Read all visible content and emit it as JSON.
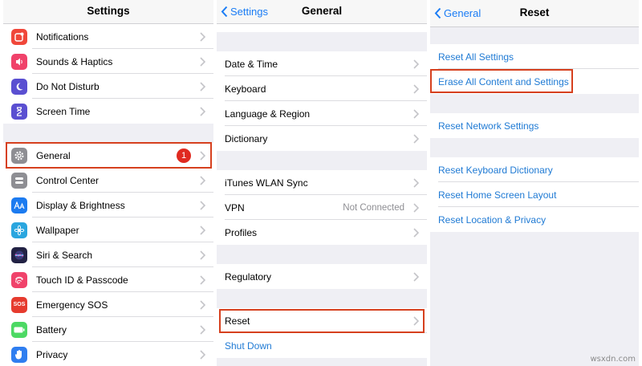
{
  "settings": {
    "title": "Settings",
    "group1": [
      {
        "label": "Notifications",
        "color": "#f0473a"
      },
      {
        "label": "Sounds & Haptics",
        "color": "#f0426a"
      },
      {
        "label": "Do Not Disturb",
        "color": "#5a4fd1"
      },
      {
        "label": "Screen Time",
        "color": "#5a4fd1"
      }
    ],
    "general": {
      "label": "General",
      "badge": "1",
      "color": "#8e8e93"
    },
    "group2": [
      {
        "label": "Control Center",
        "color": "#8e8e93"
      },
      {
        "label": "Display & Brightness",
        "color": "#1c7bf0"
      },
      {
        "label": "Wallpaper",
        "color": "#2aa6df"
      },
      {
        "label": "Siri & Search",
        "color": "#222244"
      },
      {
        "label": "Touch ID & Passcode",
        "color": "#f0426a"
      },
      {
        "label": "Emergency SOS",
        "color": "#e63b2e",
        "icon_text": "SOS"
      },
      {
        "label": "Battery",
        "color": "#4cd964"
      },
      {
        "label": "Privacy",
        "color": "#2f7ef0"
      }
    ]
  },
  "general": {
    "title": "General",
    "back": "Settings",
    "group1": [
      {
        "label": "Date & Time"
      },
      {
        "label": "Keyboard"
      },
      {
        "label": "Language & Region"
      },
      {
        "label": "Dictionary"
      }
    ],
    "group2": [
      {
        "label": "iTunes WLAN Sync"
      },
      {
        "label": "VPN",
        "detail": "Not Connected"
      },
      {
        "label": "Profiles"
      }
    ],
    "regulatory": "Regulatory",
    "reset": "Reset",
    "shutdown": "Shut Down"
  },
  "reset": {
    "title": "Reset",
    "back": "General",
    "group1": [
      "Reset All Settings",
      "Erase All Content and Settings"
    ],
    "group2": [
      "Reset Network Settings"
    ],
    "group3": [
      "Reset Keyboard Dictionary",
      "Reset Home Screen Layout",
      "Reset Location & Privacy"
    ]
  },
  "watermark": "wsxdn.com",
  "colors": {
    "link": "#1f7ad4",
    "highlight": "#d6401e",
    "badge": "#e02a20"
  }
}
